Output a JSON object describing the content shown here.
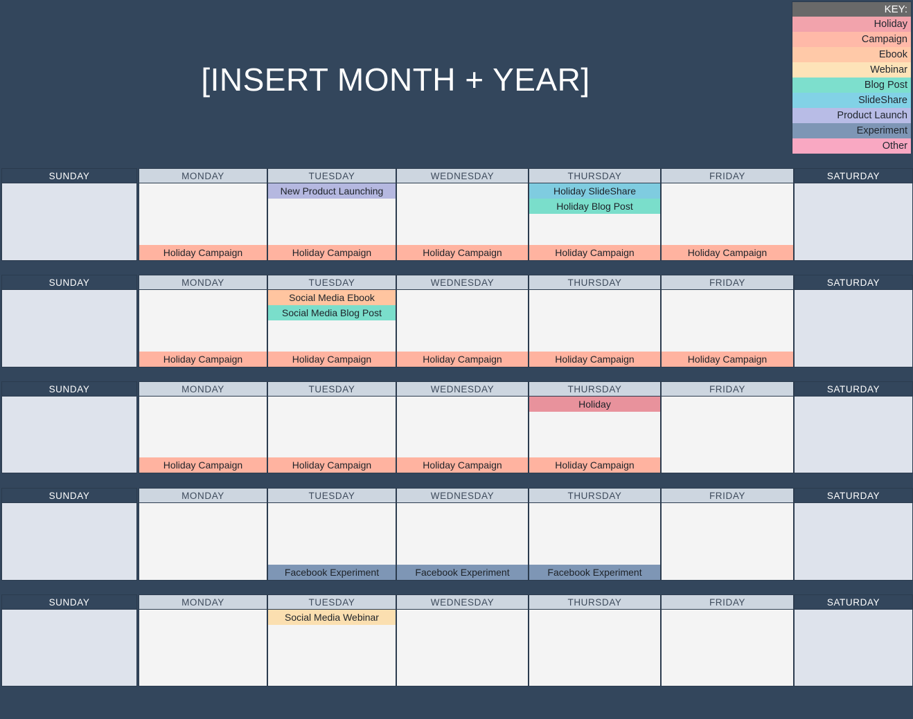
{
  "title": "[INSERT MONTH + YEAR]",
  "key": {
    "label": "KEY:",
    "items": [
      {
        "label": "Holiday",
        "color": "#f2a3ac"
      },
      {
        "label": "Campaign",
        "color": "#ffb9a8"
      },
      {
        "label": "Ebook",
        "color": "#ffc9a8"
      },
      {
        "label": "Webinar",
        "color": "#fde3b8"
      },
      {
        "label": "Blog Post",
        "color": "#7ddfcd"
      },
      {
        "label": "SlideShare",
        "color": "#82d2e6"
      },
      {
        "label": "Product Launch",
        "color": "#b8bce6"
      },
      {
        "label": "Experiment",
        "color": "#7e96b5"
      },
      {
        "label": "Other",
        "color": "#f9a8c2"
      }
    ]
  },
  "day_headers": [
    "SUNDAY",
    "MONDAY",
    "TUESDAY",
    "WEDNESDAY",
    "THURSDAY",
    "FRIDAY",
    "SATURDAY"
  ],
  "colors": {
    "holiday": "#e8929c",
    "campaign": "#ffb3a0",
    "ebook": "#ffc5a0",
    "webinar": "#fbdfb0",
    "blog_post": "#7adecb",
    "slideshare": "#7fcce0",
    "product_launch": "#b5b8e0",
    "experiment": "#7e96b5",
    "other": "#f9a8c2",
    "frame": "#33465c",
    "header_weekday": "#cdd6e0",
    "cell_weekday": "#f4f4f4",
    "cell_weekend": "#dee3ec"
  },
  "weeks": [
    {
      "days": [
        {
          "day": "SUNDAY",
          "weekend": true,
          "events": []
        },
        {
          "day": "MONDAY",
          "weekend": false,
          "events": [
            {
              "label": "Holiday Campaign",
              "type": "campaign",
              "position": "bottom"
            }
          ]
        },
        {
          "day": "TUESDAY",
          "weekend": false,
          "events": [
            {
              "label": "New Product Launching",
              "type": "product_launch",
              "position": "top"
            },
            {
              "label": "Holiday Campaign",
              "type": "campaign",
              "position": "bottom"
            }
          ]
        },
        {
          "day": "WEDNESDAY",
          "weekend": false,
          "events": [
            {
              "label": "Holiday Campaign",
              "type": "campaign",
              "position": "bottom"
            }
          ]
        },
        {
          "day": "THURSDAY",
          "weekend": false,
          "events": [
            {
              "label": "Holiday SlideShare",
              "type": "slideshare",
              "position": "top"
            },
            {
              "label": "Holiday Blog Post",
              "type": "blog_post",
              "position": "top"
            },
            {
              "label": "Holiday Campaign",
              "type": "campaign",
              "position": "bottom"
            }
          ]
        },
        {
          "day": "FRIDAY",
          "weekend": false,
          "events": [
            {
              "label": "Holiday Campaign",
              "type": "campaign",
              "position": "bottom"
            }
          ]
        },
        {
          "day": "SATURDAY",
          "weekend": true,
          "events": []
        }
      ]
    },
    {
      "days": [
        {
          "day": "SUNDAY",
          "weekend": true,
          "events": []
        },
        {
          "day": "MONDAY",
          "weekend": false,
          "events": [
            {
              "label": "Holiday Campaign",
              "type": "campaign",
              "position": "bottom"
            }
          ]
        },
        {
          "day": "TUESDAY",
          "weekend": false,
          "events": [
            {
              "label": "Social Media Ebook",
              "type": "ebook",
              "position": "top"
            },
            {
              "label": "Social Media Blog Post",
              "type": "blog_post",
              "position": "top"
            },
            {
              "label": "Holiday Campaign",
              "type": "campaign",
              "position": "bottom"
            }
          ]
        },
        {
          "day": "WEDNESDAY",
          "weekend": false,
          "events": [
            {
              "label": "Holiday Campaign",
              "type": "campaign",
              "position": "bottom"
            }
          ]
        },
        {
          "day": "THURSDAY",
          "weekend": false,
          "events": [
            {
              "label": "Holiday Campaign",
              "type": "campaign",
              "position": "bottom"
            }
          ]
        },
        {
          "day": "FRIDAY",
          "weekend": false,
          "events": [
            {
              "label": "Holiday Campaign",
              "type": "campaign",
              "position": "bottom"
            }
          ]
        },
        {
          "day": "SATURDAY",
          "weekend": true,
          "events": []
        }
      ]
    },
    {
      "days": [
        {
          "day": "SUNDAY",
          "weekend": true,
          "events": []
        },
        {
          "day": "MONDAY",
          "weekend": false,
          "events": [
            {
              "label": "Holiday Campaign",
              "type": "campaign",
              "position": "bottom"
            }
          ]
        },
        {
          "day": "TUESDAY",
          "weekend": false,
          "events": [
            {
              "label": "Holiday Campaign",
              "type": "campaign",
              "position": "bottom"
            }
          ]
        },
        {
          "day": "WEDNESDAY",
          "weekend": false,
          "events": [
            {
              "label": "Holiday Campaign",
              "type": "campaign",
              "position": "bottom"
            }
          ]
        },
        {
          "day": "THURSDAY",
          "weekend": false,
          "events": [
            {
              "label": "Holiday",
              "type": "holiday",
              "position": "top"
            },
            {
              "label": "Holiday Campaign",
              "type": "campaign",
              "position": "bottom"
            }
          ]
        },
        {
          "day": "FRIDAY",
          "weekend": false,
          "events": []
        },
        {
          "day": "SATURDAY",
          "weekend": true,
          "events": []
        }
      ]
    },
    {
      "days": [
        {
          "day": "SUNDAY",
          "weekend": true,
          "events": []
        },
        {
          "day": "MONDAY",
          "weekend": false,
          "events": []
        },
        {
          "day": "TUESDAY",
          "weekend": false,
          "events": [
            {
              "label": "Facebook Experiment",
              "type": "experiment",
              "position": "bottom"
            }
          ]
        },
        {
          "day": "WEDNESDAY",
          "weekend": false,
          "events": [
            {
              "label": "Facebook Experiment",
              "type": "experiment",
              "position": "bottom"
            }
          ]
        },
        {
          "day": "THURSDAY",
          "weekend": false,
          "events": [
            {
              "label": "Facebook Experiment",
              "type": "experiment",
              "position": "bottom"
            }
          ]
        },
        {
          "day": "FRIDAY",
          "weekend": false,
          "events": []
        },
        {
          "day": "SATURDAY",
          "weekend": true,
          "events": []
        }
      ]
    },
    {
      "days": [
        {
          "day": "SUNDAY",
          "weekend": true,
          "events": []
        },
        {
          "day": "MONDAY",
          "weekend": false,
          "events": []
        },
        {
          "day": "TUESDAY",
          "weekend": false,
          "events": [
            {
              "label": "Social Media Webinar",
              "type": "webinar",
              "position": "top"
            }
          ]
        },
        {
          "day": "WEDNESDAY",
          "weekend": false,
          "events": []
        },
        {
          "day": "THURSDAY",
          "weekend": false,
          "events": []
        },
        {
          "day": "FRIDAY",
          "weekend": false,
          "events": []
        },
        {
          "day": "SATURDAY",
          "weekend": true,
          "events": []
        }
      ]
    }
  ]
}
